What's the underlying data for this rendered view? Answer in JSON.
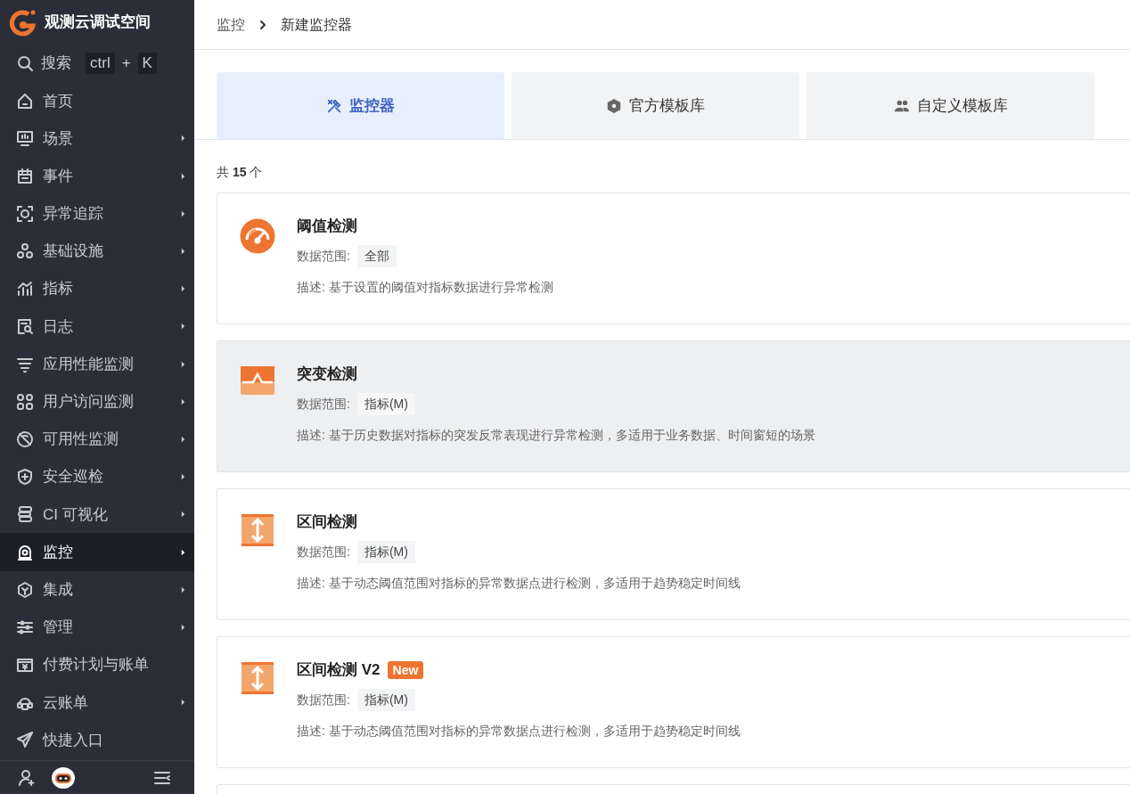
{
  "sidebar": {
    "workspace": "观测云调试空间",
    "search": {
      "label": "搜索",
      "shortcut": [
        {
          "text": "ctrl",
          "kind": "key"
        },
        {
          "text": "+",
          "kind": "separator"
        },
        {
          "text": "K",
          "kind": "key"
        }
      ]
    },
    "items": [
      {
        "label": "首页",
        "submenu": false,
        "selected": false
      },
      {
        "label": "场景",
        "submenu": true,
        "selected": false
      },
      {
        "label": "事件",
        "submenu": true,
        "selected": false
      },
      {
        "label": "异常追踪",
        "submenu": true,
        "selected": false
      },
      {
        "label": "基础设施",
        "submenu": true,
        "selected": false
      },
      {
        "label": "指标",
        "submenu": true,
        "selected": false
      },
      {
        "label": "日志",
        "submenu": true,
        "selected": false
      },
      {
        "label": "应用性能监测",
        "submenu": true,
        "selected": false
      },
      {
        "label": "用户访问监测",
        "submenu": true,
        "selected": false
      },
      {
        "label": "可用性监测",
        "submenu": true,
        "selected": false
      },
      {
        "label": "安全巡检",
        "submenu": true,
        "selected": false
      },
      {
        "label": "CI 可视化",
        "submenu": true,
        "selected": false
      },
      {
        "label": "监控",
        "submenu": true,
        "selected": true
      },
      {
        "label": "集成",
        "submenu": true,
        "selected": false
      },
      {
        "label": "管理",
        "submenu": true,
        "selected": false
      },
      {
        "label": "付费计划与账单",
        "submenu": false,
        "selected": false
      },
      {
        "label": "云账单",
        "submenu": true,
        "selected": false
      },
      {
        "label": "快捷入口",
        "submenu": false,
        "selected": false
      }
    ]
  },
  "breadcrumb": [
    "监控",
    "新建监控器"
  ],
  "tabs": [
    {
      "label": "监控器",
      "selected": true
    },
    {
      "label": "官方模板库",
      "selected": false
    },
    {
      "label": "自定义模板库",
      "selected": false
    }
  ],
  "count": "共 **15** 个",
  "cards": [
    {
      "kind": "gauge",
      "title": "阈值检测",
      "scope_label": "数据范围:",
      "scope": "全部",
      "description": "描述: 基于设置的阈值对指标数据进行异常检测",
      "highlighted": false
    },
    {
      "kind": "spike",
      "title": "突变检测",
      "scope_label": "数据范围:",
      "scope": "指标(M)",
      "description": "描述: 基于历史数据对指标的突发反常表现进行异常检测，多适用于业务数据、时间窗短的场景",
      "highlighted": true
    },
    {
      "kind": "range",
      "title": "区间检测",
      "scope_label": "数据范围:",
      "scope": "指标(M)",
      "description": "描述: 基于动态阈值范围对指标的异常数据点进行检测，多适用于趋势稳定时间线",
      "highlighted": false
    },
    {
      "kind": "range",
      "title": "区间检测 V2",
      "badge": "New",
      "scope_label": "数据范围:",
      "scope": "指标(M)",
      "description": "描述: 基于动态阈值范围对指标的异常数据点进行检测，多适用于趋势稳定时间线",
      "highlighted": false
    }
  ]
}
